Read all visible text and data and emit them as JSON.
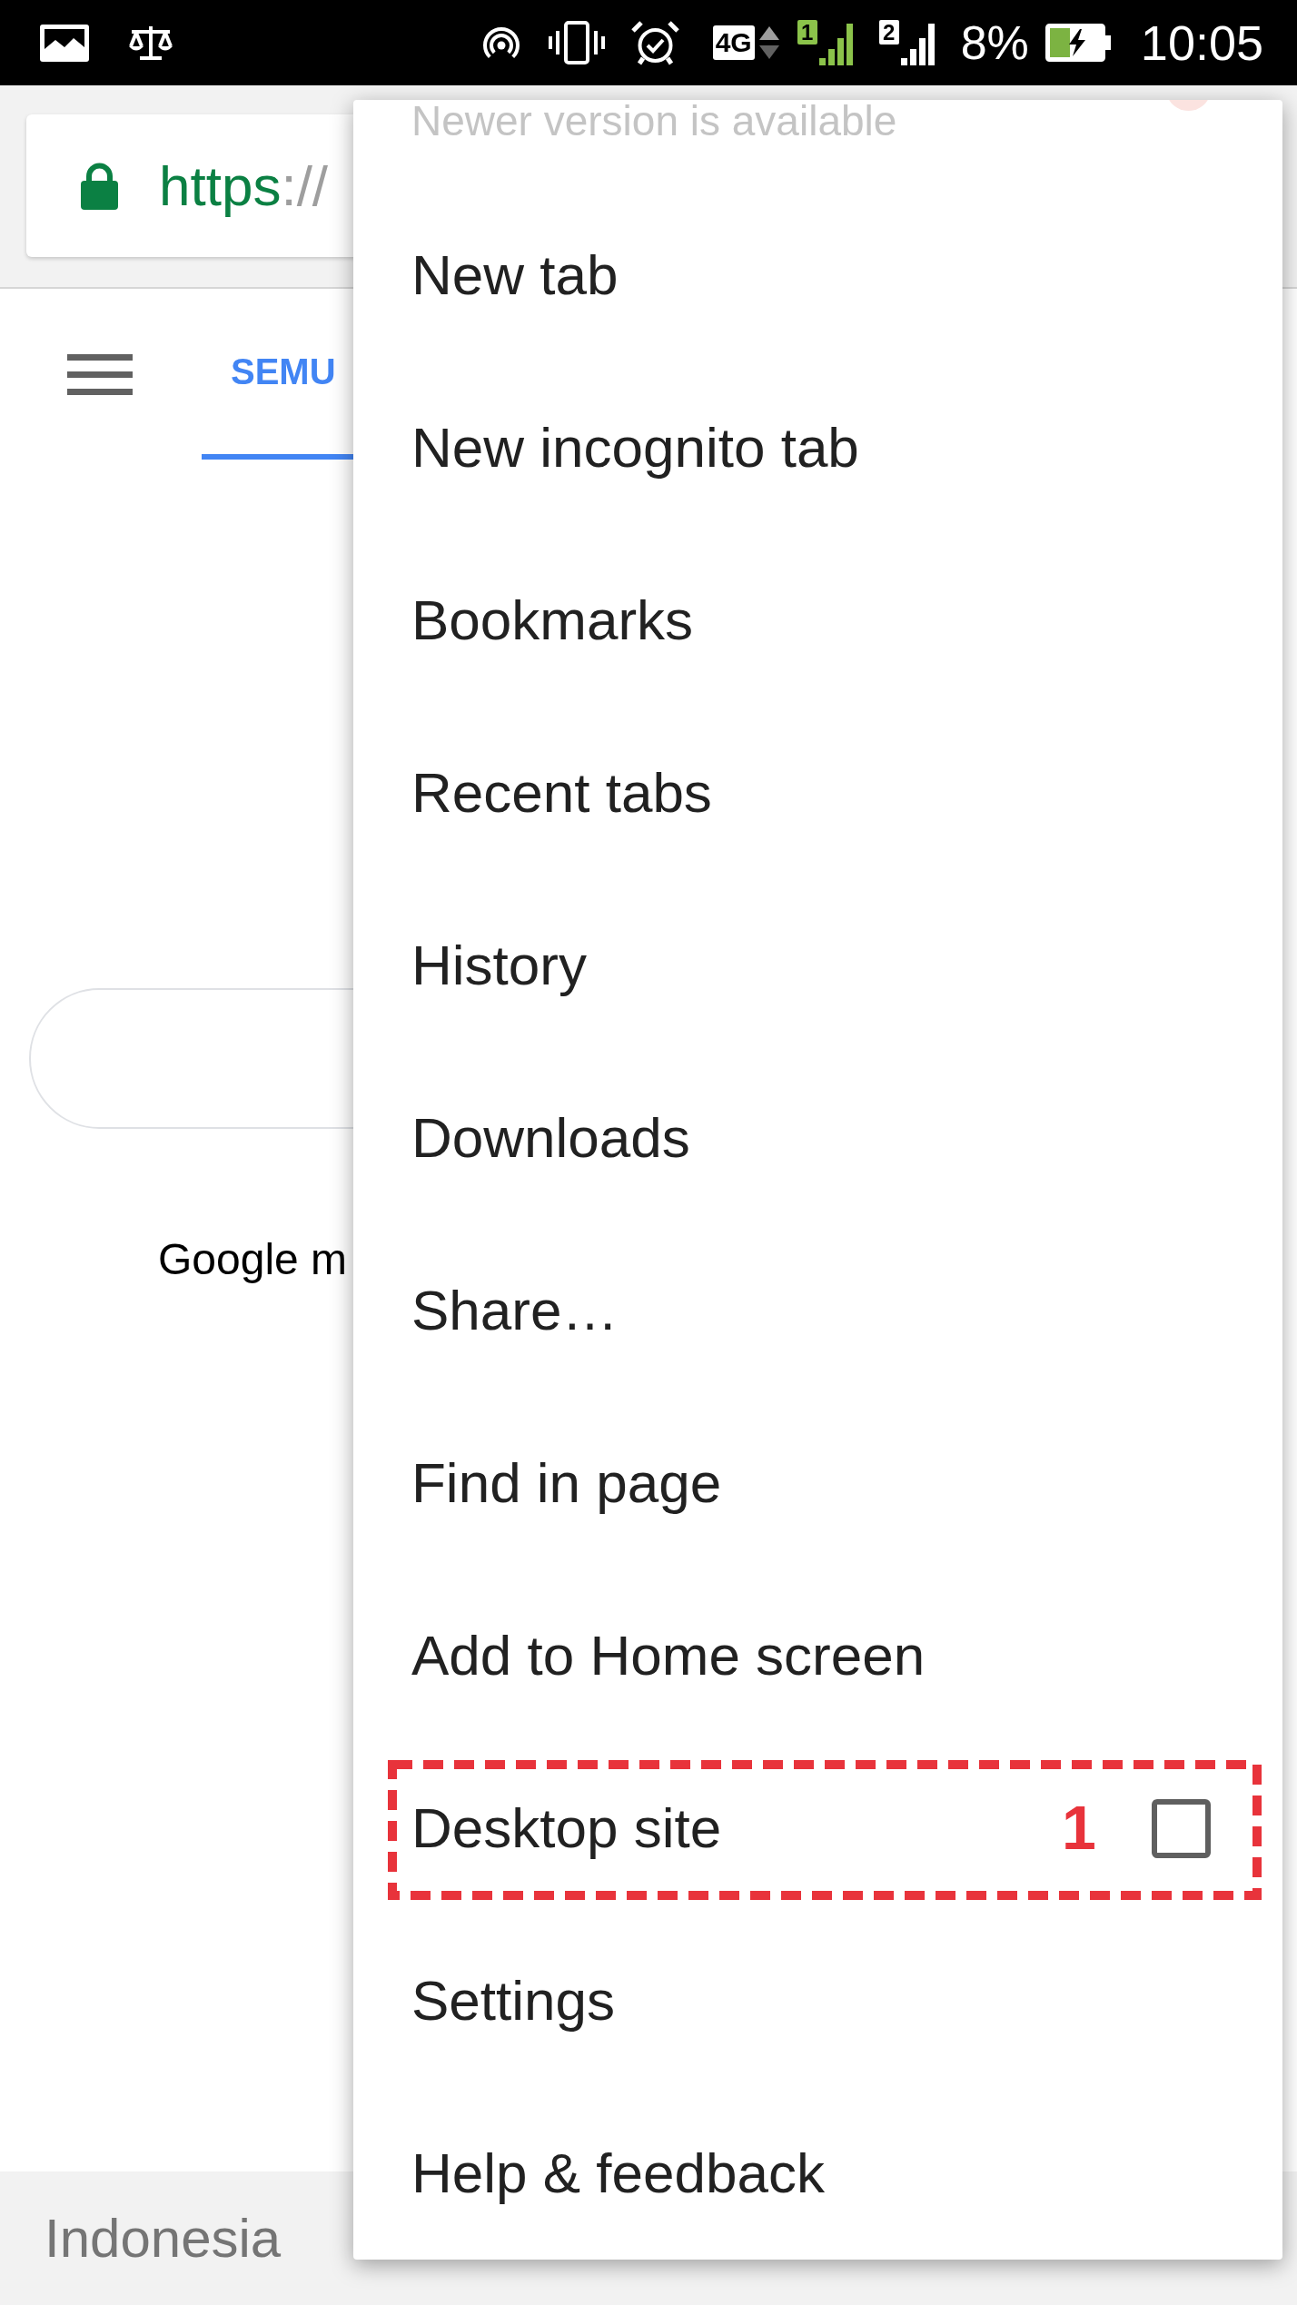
{
  "status_bar": {
    "network": "4G",
    "sims": [
      {
        "label": "1",
        "active": true
      },
      {
        "label": "2",
        "active": false
      }
    ],
    "battery": "8%",
    "time": "10:05"
  },
  "toolbar": {
    "url": {
      "scheme": "https",
      "rest": "://"
    }
  },
  "page": {
    "tabs": [
      {
        "label": "SEMU",
        "selected": true
      }
    ],
    "text": "Google m",
    "footer": "Indonesia"
  },
  "menu": {
    "notice": "Newer version is available",
    "items": [
      {
        "label": "New tab",
        "kind": "action"
      },
      {
        "label": "New incognito tab",
        "kind": "action"
      },
      {
        "label": "Bookmarks",
        "kind": "action"
      },
      {
        "label": "Recent tabs",
        "kind": "action"
      },
      {
        "label": "History",
        "kind": "action"
      },
      {
        "label": "Downloads",
        "kind": "action"
      },
      {
        "label": "Share…",
        "kind": "action"
      },
      {
        "label": "Find in page",
        "kind": "action"
      },
      {
        "label": "Add to Home screen",
        "kind": "action"
      },
      {
        "label": "Desktop site",
        "kind": "checkbox",
        "checked": false,
        "annotation": "1"
      },
      {
        "label": "Settings",
        "kind": "action"
      },
      {
        "label": "Help & feedback",
        "kind": "action"
      }
    ]
  }
}
